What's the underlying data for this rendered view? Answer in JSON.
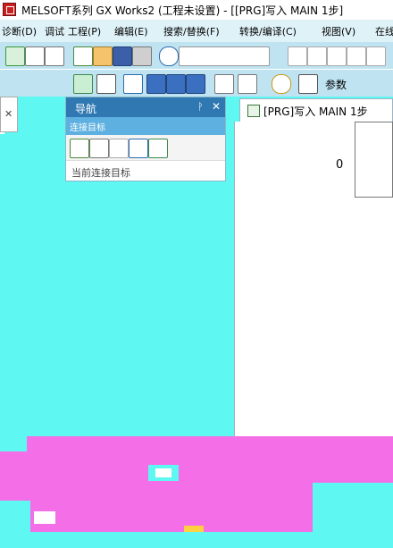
{
  "titlebar": {
    "title": "MELSOFT系列 GX Works2 (工程未设置) - [[PRG]写入 MAIN 1步]"
  },
  "menubar": {
    "items": [
      {
        "label": "工程(P)"
      },
      {
        "label": "编辑(E)"
      },
      {
        "label": "搜索/替换(F)"
      },
      {
        "label": "转换/编译(C)"
      },
      {
        "label": "视图(V)"
      },
      {
        "label": "在线"
      }
    ],
    "left_label": "诊断(D)",
    "left_label2": "调试"
  },
  "toolbar2": {
    "params_label": "参数"
  },
  "navigation": {
    "title": "导航",
    "pin": "ᚹ",
    "close": "✕",
    "connection_header": "连接目标",
    "tree_item": "当前连接目标"
  },
  "editor": {
    "tab_label": "[PRG]写入 MAIN 1步",
    "row_number": "0"
  },
  "colors": {
    "cyan": "#5ff7f2",
    "pink": "#f36ee7",
    "nav_blue": "#2f78b2"
  }
}
